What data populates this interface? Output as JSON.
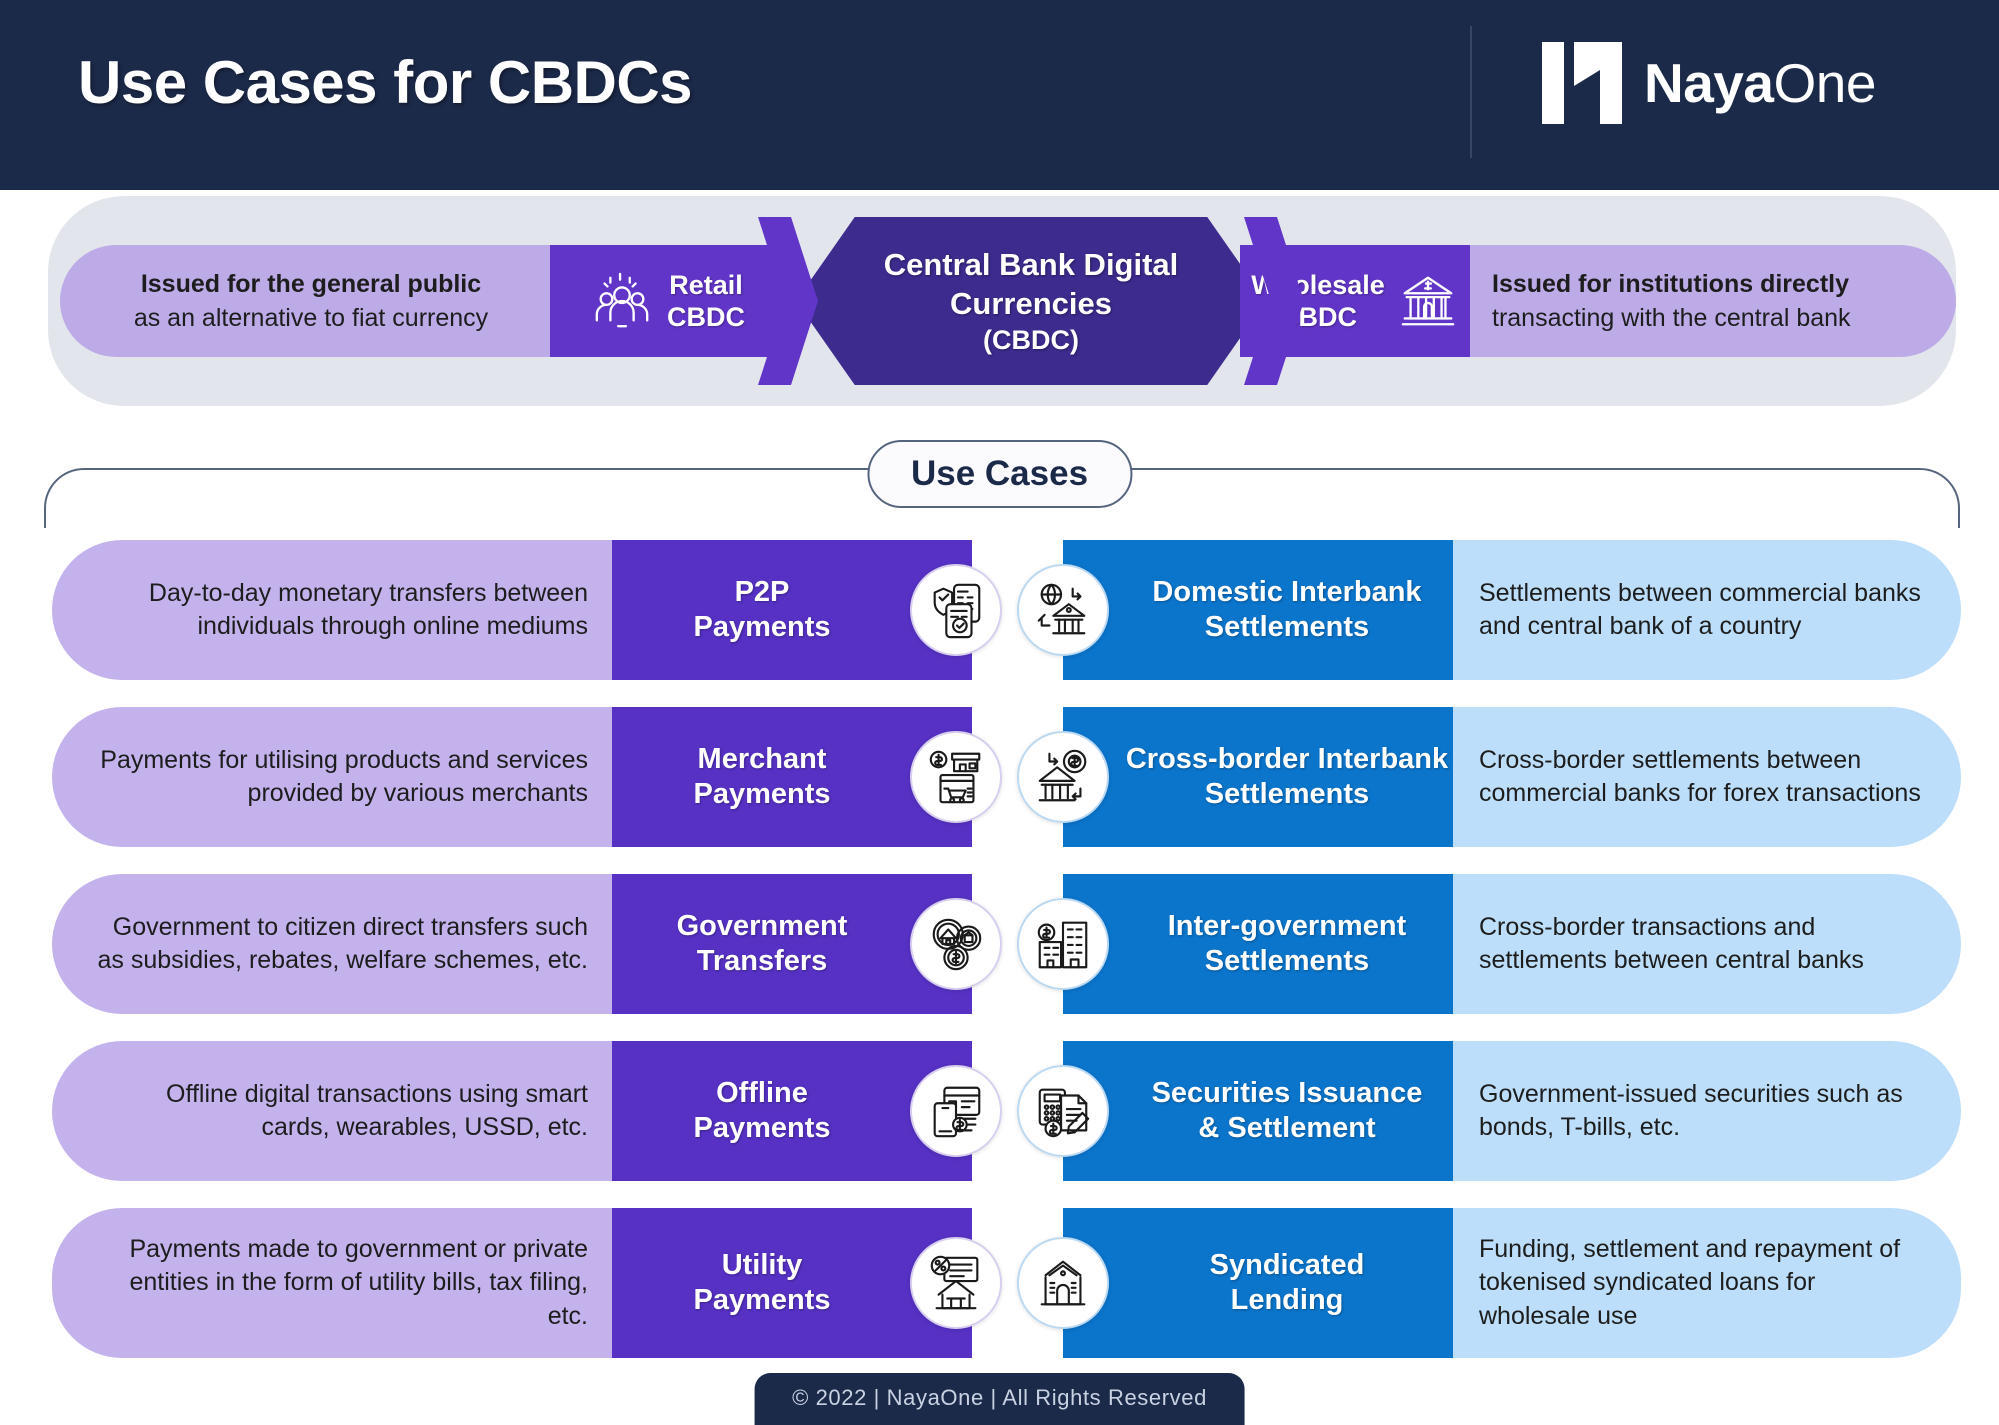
{
  "header": {
    "title": "Use Cases for CBDCs",
    "brand_bold": "Naya",
    "brand_light": "One",
    "logo_icon": "nayaone-logo-icon"
  },
  "banner": {
    "left_desc_strong": "Issued for the general public",
    "left_desc_light": "as an alternative to fiat currency",
    "left_tag_line1": "Retail",
    "left_tag_line2": "CBDC",
    "left_tag_icon": "people-group-icon",
    "center_line1": "Central Bank Digital",
    "center_line2": "Currencies",
    "center_line3": "(CBDC)",
    "right_tag_line1": "Wholesale",
    "right_tag_line2": "CBDC",
    "right_tag_icon": "bank-dollar-icon",
    "right_desc_strong": "Issued for institutions directly",
    "right_desc_light": "transacting with the central bank"
  },
  "section": {
    "use_cases_label": "Use Cases"
  },
  "retail_use_cases": [
    {
      "description": "Day-to-day monetary transfers between individuals through online mediums",
      "title_line1": "P2P",
      "title_line2": "Payments",
      "icon": "phone-shield-payment-icon"
    },
    {
      "description": "Payments for utilising products and services provided by various merchants",
      "title_line1": "Merchant",
      "title_line2": "Payments",
      "icon": "store-cart-icon"
    },
    {
      "description": "Government to citizen direct transfers such as subsidies, rebates, welfare schemes, etc.",
      "title_line1": "Government",
      "title_line2": "Transfers",
      "icon": "gears-house-dollar-icon"
    },
    {
      "description": "Offline digital transactions using smart cards, wearables, USSD, etc.",
      "title_line1": "Offline",
      "title_line2": "Payments",
      "icon": "card-phone-icon"
    },
    {
      "description": "Payments made to government or private  entities in the form of utility bills, tax filing, etc.",
      "title_line1": "Utility",
      "title_line2": "Payments",
      "icon": "bill-house-icon"
    }
  ],
  "wholesale_use_cases": [
    {
      "title_line1": "Domestic Interbank",
      "title_line2": "Settlements",
      "description": "Settlements between commercial banks and central bank of a country",
      "icon": "globe-bank-transfer-icon"
    },
    {
      "title_line1": "Cross-border Interbank",
      "title_line2": "Settlements",
      "description": "Cross-border settlements between commercial banks for forex transactions",
      "icon": "bank-coin-exchange-icon"
    },
    {
      "title_line1": "Inter-government",
      "title_line2": "Settlements",
      "description": "Cross-border transactions and settlements between central banks",
      "icon": "buildings-dollar-icon"
    },
    {
      "title_line1": "Securities Issuance",
      "title_line2": "& Settlement",
      "description": "Government-issued securities such as bonds, T-bills, etc.",
      "icon": "calculator-document-icon"
    },
    {
      "title_line1": "Syndicated",
      "title_line2": "Lending",
      "description": "Funding, settlement and repayment of tokenised syndicated loans for wholesale use",
      "icon": "bank-building-icon"
    }
  ],
  "footer": {
    "copyright": "© 2022 | NayaOne | All Rights Reserved"
  },
  "colors": {
    "navy": "#1c2a4a",
    "retail_tag": "#5631c4",
    "retail_desc": "#c3b2ec",
    "wholesale_tag": "#0b74cb",
    "wholesale_desc": "#bcdefa",
    "hex": "#3d2b8e",
    "banner_tag": "#6235c9",
    "banner_desc": "#bdabe8",
    "banner_shell": "#e3e5ec"
  }
}
